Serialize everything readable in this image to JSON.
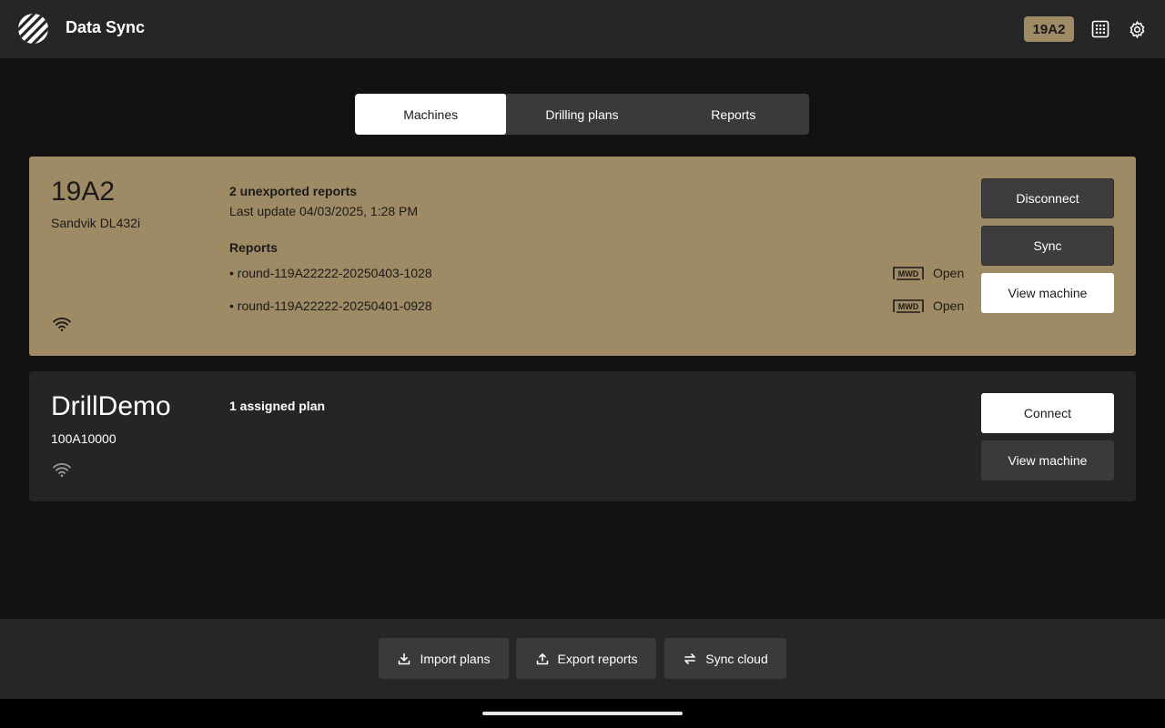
{
  "header": {
    "title": "Data Sync",
    "machine_badge": "19A2",
    "logo_icon": "striped-circle-logo",
    "grid_icon": "calculator-grid-icon",
    "settings_icon": "gear-icon"
  },
  "tabs": [
    {
      "label": "Machines",
      "active": true
    },
    {
      "label": "Drilling plans",
      "active": false
    },
    {
      "label": "Reports",
      "active": false
    }
  ],
  "machines": [
    {
      "name": "19A2",
      "model": "Sandvik DL432i",
      "summary": "2 unexported reports",
      "last_update": "Last update 04/03/2025, 1:28 PM",
      "reports_heading": "Reports",
      "reports": [
        {
          "name": "• round-119A22222-20250403-1028",
          "tag": "MWD",
          "action": "Open"
        },
        {
          "name": "• round-119A22222-20250401-0928",
          "tag": "MWD",
          "action": "Open"
        }
      ],
      "buttons": {
        "disconnect": "Disconnect",
        "sync": "Sync",
        "view": "View machine"
      },
      "connected": true,
      "background": "#9e8a64"
    },
    {
      "name": "DrillDemo",
      "model": "100A10000",
      "summary": "1 assigned plan",
      "buttons": {
        "connect": "Connect",
        "view": "View machine"
      },
      "connected": false,
      "background": "#252525"
    }
  ],
  "footer": {
    "import": "Import plans",
    "export": "Export reports",
    "sync_cloud": "Sync cloud"
  },
  "colors": {
    "accent": "#9e8a64",
    "background": "#121212",
    "surface": "#262626"
  }
}
